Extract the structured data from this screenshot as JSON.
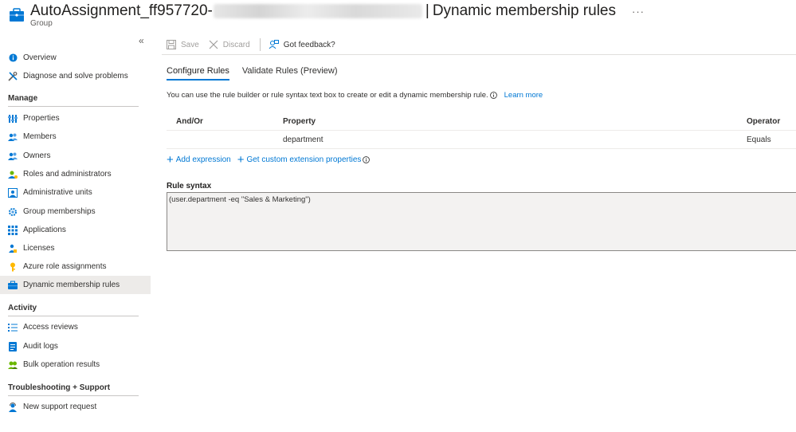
{
  "header": {
    "title_main": "AutoAssignment_ff957720-",
    "title_separator": "|",
    "title_sub": "Dynamic membership rules",
    "more": "···",
    "subtitle": "Group"
  },
  "sidebar": {
    "collapse": "«",
    "items_top": [
      {
        "label": "Overview",
        "icon": "info-icon"
      },
      {
        "label": "Diagnose and solve problems",
        "icon": "wrench-icon"
      }
    ],
    "section_manage": "Manage",
    "items_manage": [
      {
        "label": "Properties",
        "icon": "properties-icon"
      },
      {
        "label": "Members",
        "icon": "members-icon"
      },
      {
        "label": "Owners",
        "icon": "owners-icon"
      },
      {
        "label": "Roles and administrators",
        "icon": "roles-icon"
      },
      {
        "label": "Administrative units",
        "icon": "admin-units-icon"
      },
      {
        "label": "Group memberships",
        "icon": "gear-icon"
      },
      {
        "label": "Applications",
        "icon": "grid-icon"
      },
      {
        "label": "Licenses",
        "icon": "license-icon"
      },
      {
        "label": "Azure role assignments",
        "icon": "key-icon"
      },
      {
        "label": "Dynamic membership rules",
        "icon": "group-rules-icon"
      }
    ],
    "section_activity": "Activity",
    "items_activity": [
      {
        "label": "Access reviews",
        "icon": "list-check-icon"
      },
      {
        "label": "Audit logs",
        "icon": "log-icon"
      },
      {
        "label": "Bulk operation results",
        "icon": "bulk-icon"
      }
    ],
    "section_support": "Troubleshooting + Support",
    "items_support": [
      {
        "label": "New support request",
        "icon": "support-icon"
      }
    ]
  },
  "toolbar": {
    "save_label": "Save",
    "discard_label": "Discard",
    "feedback_label": "Got feedback?"
  },
  "tabs": [
    {
      "label": "Configure Rules"
    },
    {
      "label": "Validate Rules (Preview)"
    }
  ],
  "info": {
    "text": "You can use the rule builder or rule syntax text box to create or edit a dynamic membership rule.",
    "link": "Learn more"
  },
  "table": {
    "headers": [
      "And/Or",
      "Property",
      "Operator"
    ],
    "rows": [
      {
        "and_or": "",
        "property": "department",
        "operator": "Equals"
      }
    ]
  },
  "actions": {
    "add_expression": "Add expression",
    "custom_props": "Get custom extension properties"
  },
  "rule": {
    "label": "Rule syntax",
    "value": "(user.department -eq \"Sales & Marketing\")"
  },
  "colors": {
    "accent": "#0078d4",
    "active_bg": "#edebe9"
  }
}
